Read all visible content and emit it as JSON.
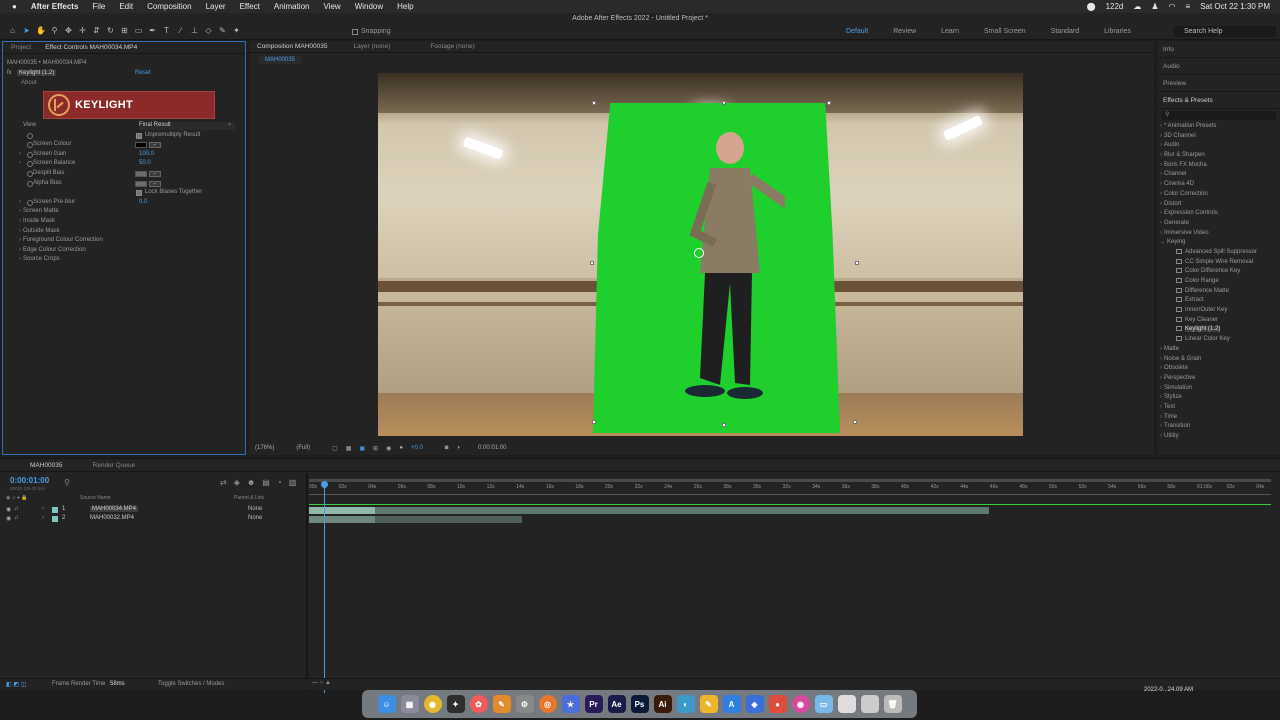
{
  "menubar": {
    "app_name": "After Effects",
    "items": [
      "File",
      "Edit",
      "Composition",
      "Layer",
      "Effect",
      "Animation",
      "View",
      "Window",
      "Help"
    ],
    "battery": "122d",
    "datetime": "Sat Oct 22  1:30 PM"
  },
  "window_title": "Adobe After Effects 2022 - Untitled Project *",
  "toolbar": {
    "snapping_label": "Snapping",
    "workspaces": [
      "Default",
      "Review",
      "Learn",
      "Small Screen",
      "Standard",
      "Libraries"
    ],
    "active_workspace": "Default",
    "search_placeholder": "Search Help"
  },
  "left_panel": {
    "tabs": [
      "Project",
      "Effect Controls MAH00034.MP4"
    ],
    "header": "MAH00035 • MAH00034.MP4",
    "effect_name": "Keylight (1.2)",
    "reset_label": "Reset",
    "about_label": "About",
    "logo_text": "KEYLIGHT",
    "view_label": "View",
    "view_value": "Final Result",
    "unpremultiply_label": "Unpremultiply Result",
    "screen_colour_label": "Screen Colour",
    "screen_gain_label": "Screen Gain",
    "screen_gain_value": "100.0",
    "screen_balance_label": "Screen Balance",
    "screen_balance_value": "50.0",
    "despill_bias_label": "Despill Bias",
    "alpha_bias_label": "Alpha Bias",
    "lock_biases_label": "Lock Biases Together",
    "screen_preblur_label": "Screen Pre-blur",
    "screen_preblur_value": "0.0",
    "groups": [
      "Screen Matte",
      "Inside Mask",
      "Outside Mask",
      "Foreground Colour Correction",
      "Edge Colour Correction",
      "Source Crops"
    ]
  },
  "viewer": {
    "tabs": [
      "Composition MAH00035",
      "Layer (none)",
      "Footage (none)"
    ],
    "comp_name": "MAH00035",
    "zoom": "(176%)",
    "resolution": "(Full)",
    "exposure": "+0.0",
    "timecode": "0:00:01:00"
  },
  "right_panel": {
    "tabs": [
      "Info",
      "Audio",
      "Preview"
    ],
    "effects_title": "Effects & Presets",
    "search_placeholder": "",
    "categories_top": [
      "* Animation Presets",
      "3D Channel",
      "Audio",
      "Blur & Sharpen",
      "Boris FX Mocha",
      "Channel",
      "Cinema 4D",
      "Color Correction",
      "Distort",
      "Expression Controls",
      "Generate",
      "Immersive Video"
    ],
    "open_category": "Keying",
    "keying_items": [
      "Advanced Spill Suppressor",
      "CC Simple Wire Removal",
      "Color Difference Key",
      "Color Range",
      "Difference Matte",
      "Extract",
      "Inner/Outer Key",
      "Key Cleaner",
      "Keylight (1.2)",
      "Linear Color Key"
    ],
    "selected_item": "Keylight (1.2)",
    "categories_bottom": [
      "Matte",
      "Noise & Grain",
      "Obsolete",
      "Perspective",
      "Simulation",
      "Stylize",
      "Text",
      "Time",
      "Transition",
      "Utility"
    ]
  },
  "timeline": {
    "tabs": [
      "MAH00035",
      "Render Queue"
    ],
    "timecode": "0:00:01:00",
    "fps": "00025 (25.00 fps)",
    "col_source": "Source Name",
    "col_parent": "Parent & Link",
    "layers": [
      {
        "num": "1",
        "name": "MAH00034.MP4",
        "parent": "None"
      },
      {
        "num": "2",
        "name": "MAH00032.MP4",
        "parent": "None"
      }
    ],
    "ticks": [
      "00s",
      "02s",
      "04s",
      "06s",
      "08s",
      "10s",
      "12s",
      "14s",
      "16s",
      "18s",
      "20s",
      "22s",
      "24s",
      "26s",
      "28s",
      "30s",
      "32s",
      "34s",
      "36s",
      "38s",
      "40s",
      "42s",
      "44s",
      "46s",
      "48s",
      "50s",
      "52s",
      "54s",
      "56s",
      "58s",
      "01:00s",
      "02s",
      "04s"
    ]
  },
  "statusbar": {
    "render_label": "Frame Render Time",
    "render_value": "58ms",
    "toggle_label": "Toggle Switches / Modes"
  },
  "dock": {
    "apps": [
      "Finder",
      "Launchpad",
      "Chrome",
      "Safari",
      "Photos",
      "Pages",
      "Settings",
      "Blender",
      "Notes",
      "Premiere Pro",
      "After Effects",
      "Photoshop",
      "Illustrator",
      "Finder2",
      "App Store",
      "Numbers",
      "Keynote",
      "Sketch",
      "Trash"
    ]
  },
  "datestamp": "2022-0...24.09 AM"
}
